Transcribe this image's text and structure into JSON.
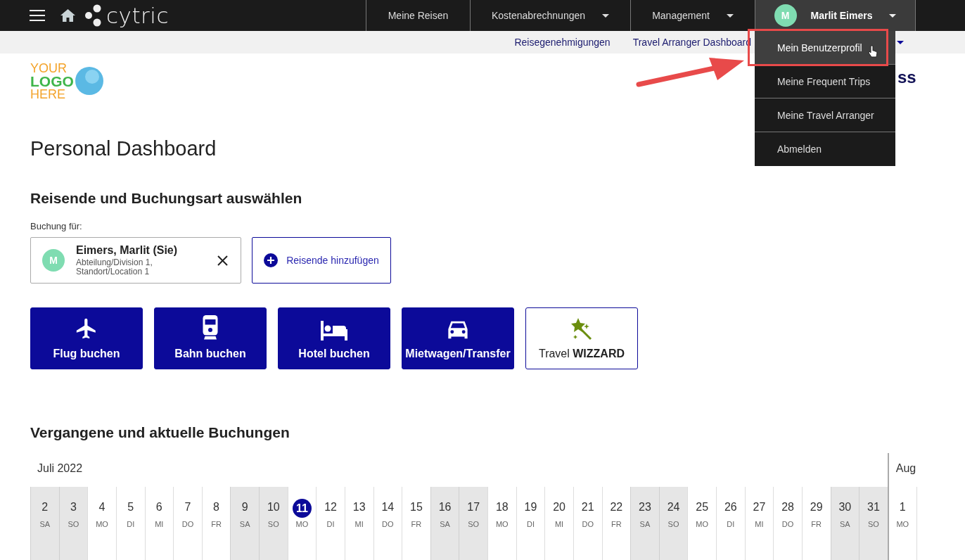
{
  "topbar": {
    "brand": "cytric",
    "nav": [
      {
        "label": "Meine Reisen",
        "has_caret": false
      },
      {
        "label": "Kostenabrechnungen",
        "has_caret": true
      },
      {
        "label": "Management",
        "has_caret": true
      }
    ],
    "user": {
      "initial": "M",
      "name": "Marlit Eimers",
      "expanded": true
    }
  },
  "subnav": {
    "links": [
      "Reisegenehmigungen",
      "Travel Arranger Dashboard"
    ]
  },
  "user_menu": {
    "items": [
      {
        "label": "Mein Benutzerprofil",
        "selected": true
      },
      {
        "label": "Meine Frequent Trips",
        "selected": false
      },
      {
        "label": "Meine Travel Arranger",
        "selected": false
      },
      {
        "label": "Abmelden",
        "selected": false
      }
    ]
  },
  "logo": {
    "lines": [
      "YOUR",
      "LOGO",
      "HERE"
    ]
  },
  "header_fragment": "ss",
  "title": "Personal Dashboard",
  "traveller_section": {
    "heading": "Reisende und Buchungsart auswählen",
    "booking_for_label": "Buchung für:",
    "traveller": {
      "initial": "M",
      "name": "Eimers, Marlit (Sie)",
      "detail": "Abteilung/Division 1, Standort/Location 1"
    },
    "add_button": "Reisende hinzufügen"
  },
  "booking_tiles": [
    {
      "kind": "flight",
      "label": "Flug buchen"
    },
    {
      "kind": "rail",
      "label": "Bahn buchen"
    },
    {
      "kind": "hotel",
      "label": "Hotel buchen"
    },
    {
      "kind": "car",
      "label": "Mietwagen/Transfer"
    },
    {
      "kind": "wizard",
      "label": "Travel **WIZZARD**"
    }
  ],
  "bookings_section": {
    "heading": "Vergangene und aktuelle Buchungen",
    "months": [
      {
        "label": "Juli 2022",
        "days": [
          {
            "day": "2",
            "weekday": "SA",
            "weekend": true,
            "selected": false
          },
          {
            "day": "3",
            "weekday": "SO",
            "weekend": true,
            "selected": false
          },
          {
            "day": "4",
            "weekday": "MO",
            "weekend": false,
            "selected": false
          },
          {
            "day": "5",
            "weekday": "DI",
            "weekend": false,
            "selected": false
          },
          {
            "day": "6",
            "weekday": "MI",
            "weekend": false,
            "selected": false
          },
          {
            "day": "7",
            "weekday": "DO",
            "weekend": false,
            "selected": false
          },
          {
            "day": "8",
            "weekday": "FR",
            "weekend": false,
            "selected": false
          },
          {
            "day": "9",
            "weekday": "SA",
            "weekend": true,
            "selected": false
          },
          {
            "day": "10",
            "weekday": "SO",
            "weekend": true,
            "selected": false
          },
          {
            "day": "11",
            "weekday": "MO",
            "weekend": false,
            "selected": true
          },
          {
            "day": "12",
            "weekday": "DI",
            "weekend": false,
            "selected": false
          },
          {
            "day": "13",
            "weekday": "MI",
            "weekend": false,
            "selected": false
          },
          {
            "day": "14",
            "weekday": "DO",
            "weekend": false,
            "selected": false
          },
          {
            "day": "15",
            "weekday": "FR",
            "weekend": false,
            "selected": false
          },
          {
            "day": "16",
            "weekday": "SA",
            "weekend": true,
            "selected": false
          },
          {
            "day": "17",
            "weekday": "SO",
            "weekend": true,
            "selected": false
          },
          {
            "day": "18",
            "weekday": "MO",
            "weekend": false,
            "selected": false
          },
          {
            "day": "19",
            "weekday": "DI",
            "weekend": false,
            "selected": false
          },
          {
            "day": "20",
            "weekday": "MI",
            "weekend": false,
            "selected": false
          },
          {
            "day": "21",
            "weekday": "DO",
            "weekend": false,
            "selected": false
          },
          {
            "day": "22",
            "weekday": "FR",
            "weekend": false,
            "selected": false
          },
          {
            "day": "23",
            "weekday": "SA",
            "weekend": true,
            "selected": false
          },
          {
            "day": "24",
            "weekday": "SO",
            "weekend": true,
            "selected": false
          },
          {
            "day": "25",
            "weekday": "MO",
            "weekend": false,
            "selected": false
          },
          {
            "day": "26",
            "weekday": "DI",
            "weekend": false,
            "selected": false
          },
          {
            "day": "27",
            "weekday": "MI",
            "weekend": false,
            "selected": false
          },
          {
            "day": "28",
            "weekday": "DO",
            "weekend": false,
            "selected": false
          },
          {
            "day": "29",
            "weekday": "FR",
            "weekend": false,
            "selected": false
          },
          {
            "day": "30",
            "weekday": "SA",
            "weekend": true,
            "selected": false
          },
          {
            "day": "31",
            "weekday": "SO",
            "weekend": true,
            "selected": false
          }
        ]
      },
      {
        "label": "Aug",
        "days": [
          {
            "day": "1",
            "weekday": "MO",
            "weekend": false,
            "selected": false
          }
        ]
      }
    ]
  }
}
